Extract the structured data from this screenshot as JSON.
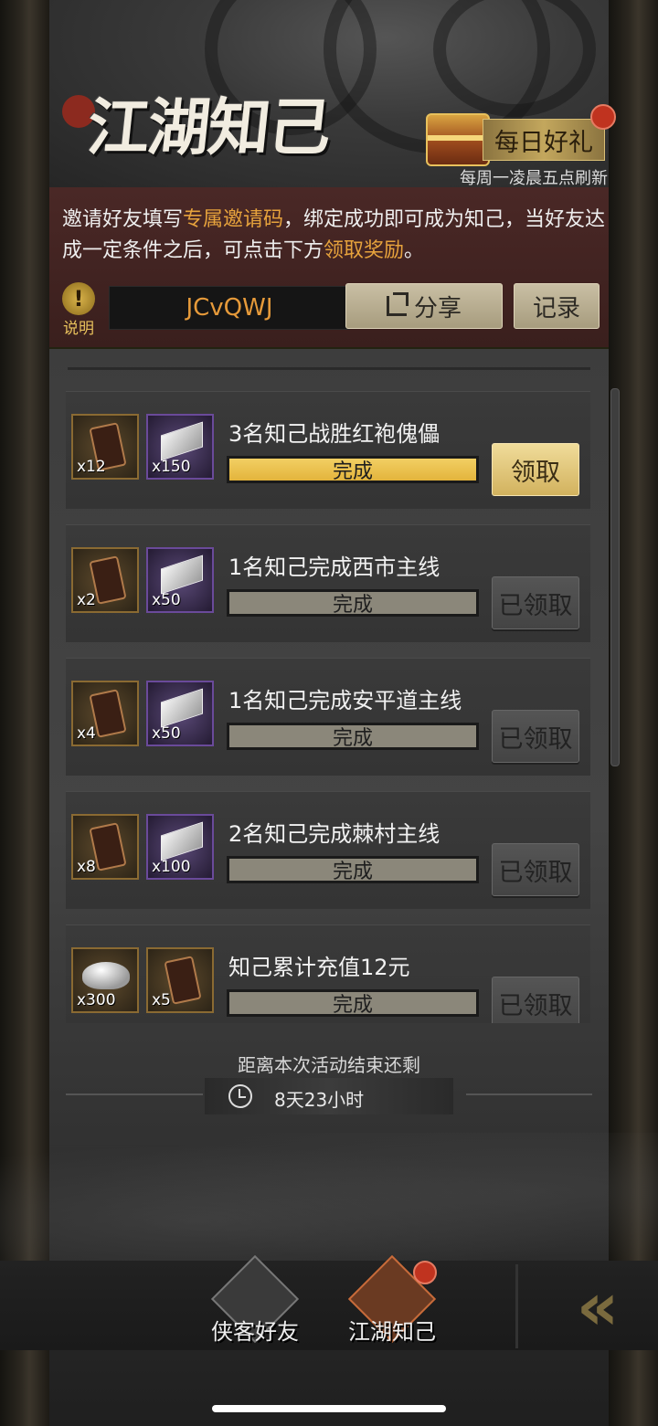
{
  "header": {
    "title": "江湖知己",
    "daily_gift_label": "每日好礼",
    "refresh_note": "每周一凌晨五点刷新"
  },
  "invite": {
    "text_before": "邀请好友填写",
    "highlight1": "专属邀请码",
    "text_middle": "，绑定成功即可成为知己，当好友达成一定条件之后，可点击下方",
    "highlight2": "领取奖励",
    "text_after": "。",
    "info_label": "说明",
    "info_glyph": "!",
    "invite_code": "JCvQWJ",
    "share_label": "分享",
    "record_label": "记录"
  },
  "tasks": [
    {
      "title": "3名知己战胜红袍傀儡",
      "rewards": [
        {
          "icon": "token-icon",
          "qty": "x12",
          "rarity": "gold"
        },
        {
          "icon": "ingot-icon",
          "qty": "x150",
          "rarity": "purple"
        }
      ],
      "progress_label": "完成",
      "progress_active": true,
      "button_label": "领取",
      "claimed": false
    },
    {
      "title": "1名知己完成西市主线",
      "rewards": [
        {
          "icon": "token-icon",
          "qty": "x2",
          "rarity": "gold"
        },
        {
          "icon": "ingot-icon",
          "qty": "x50",
          "rarity": "purple"
        }
      ],
      "progress_label": "完成",
      "progress_active": false,
      "button_label": "已领取",
      "claimed": true
    },
    {
      "title": "1名知己完成安平道主线",
      "rewards": [
        {
          "icon": "token-icon",
          "qty": "x4",
          "rarity": "gold"
        },
        {
          "icon": "ingot-icon",
          "qty": "x50",
          "rarity": "purple"
        }
      ],
      "progress_label": "完成",
      "progress_active": false,
      "button_label": "已领取",
      "claimed": true
    },
    {
      "title": "2名知己完成棘村主线",
      "rewards": [
        {
          "icon": "token-icon",
          "qty": "x8",
          "rarity": "gold"
        },
        {
          "icon": "ingot-icon",
          "qty": "x100",
          "rarity": "purple"
        }
      ],
      "progress_label": "完成",
      "progress_active": false,
      "button_label": "已领取",
      "claimed": true
    },
    {
      "title": "知己累计充值12元",
      "rewards": [
        {
          "icon": "silver-icon",
          "qty": "x300",
          "rarity": "gold"
        },
        {
          "icon": "token-icon",
          "qty": "x5",
          "rarity": "gold"
        }
      ],
      "progress_label": "完成",
      "progress_active": false,
      "button_label": "已领取",
      "claimed": true
    }
  ],
  "countdown": {
    "label": "距离本次活动结束还剩",
    "value": "8天23小时"
  },
  "bottom_nav": {
    "tab1_label": "侠客好友",
    "tab2_label": "江湖知己",
    "collapse_glyph": "«"
  },
  "colors": {
    "accent_gold": "#e6a23c",
    "notify_red": "#c0331f",
    "progress_active": "#e3b43c"
  }
}
